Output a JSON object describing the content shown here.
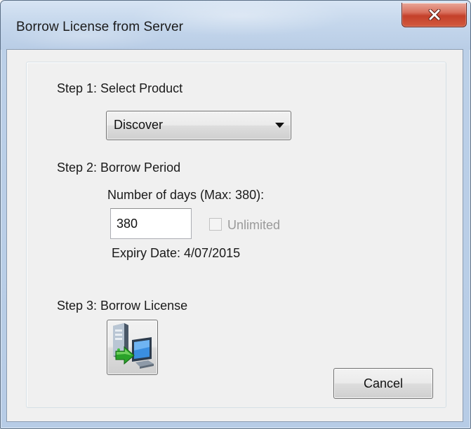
{
  "window": {
    "title": "Borrow License from Server",
    "close_symbol": "✕"
  },
  "step1": {
    "label": "Step 1: Select Product",
    "product_selected": "Discover"
  },
  "step2": {
    "label": "Step 2: Borrow Period",
    "days_label": "Number of days (Max: 380):",
    "days_value": "380",
    "unlimited_label": "Unlimited",
    "unlimited_checked": false,
    "unlimited_enabled": false,
    "expiry_text": "Expiry Date: 4/07/2015"
  },
  "step3": {
    "label": "Step 3: Borrow License",
    "borrow_button_icon": "computer-transfer-icon"
  },
  "buttons": {
    "cancel_label": "Cancel"
  },
  "colors": {
    "close_button": "#c4402a",
    "frame": "#b9cde6",
    "client_background": "#f0f0f0",
    "disabled_text": "#9a9a9a"
  }
}
